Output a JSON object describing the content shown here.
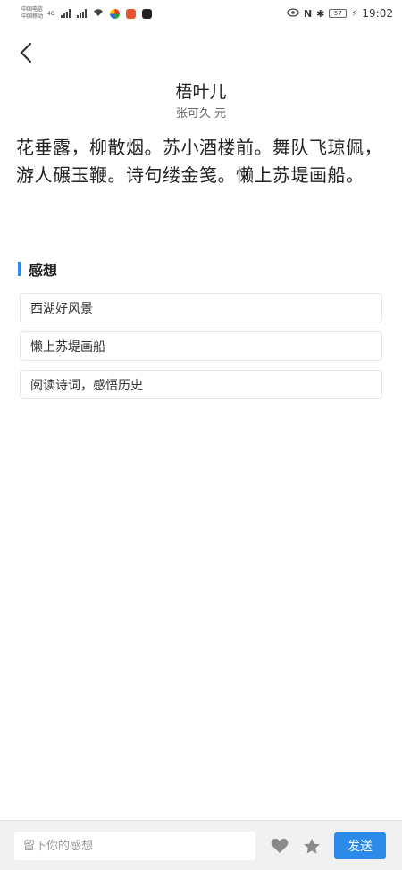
{
  "status_bar": {
    "carrier_1": "中国电信",
    "carrier_2": "中国移动",
    "network_tag": "4G",
    "nfc": "N",
    "bluetooth": "✱",
    "battery": "57",
    "time": "19:02"
  },
  "poem": {
    "title": "梧叶儿",
    "author": "张可久 元",
    "body": "花垂露，柳散烟。苏小酒楼前。舞队飞琼佩，游人碾玉鞭。诗句缕金笺。懒上苏堤画船。"
  },
  "section": {
    "title": "感想"
  },
  "comments": [
    "西湖好风景",
    "懒上苏堤画船",
    "阅读诗词，感悟历史"
  ],
  "bottom_bar": {
    "input_placeholder": "留下你的感想",
    "send_label": "发送"
  },
  "colors": {
    "accent": "#2c8ae8",
    "section_bar": "#2b8ce6",
    "icon_gray": "#8a8a8a"
  }
}
